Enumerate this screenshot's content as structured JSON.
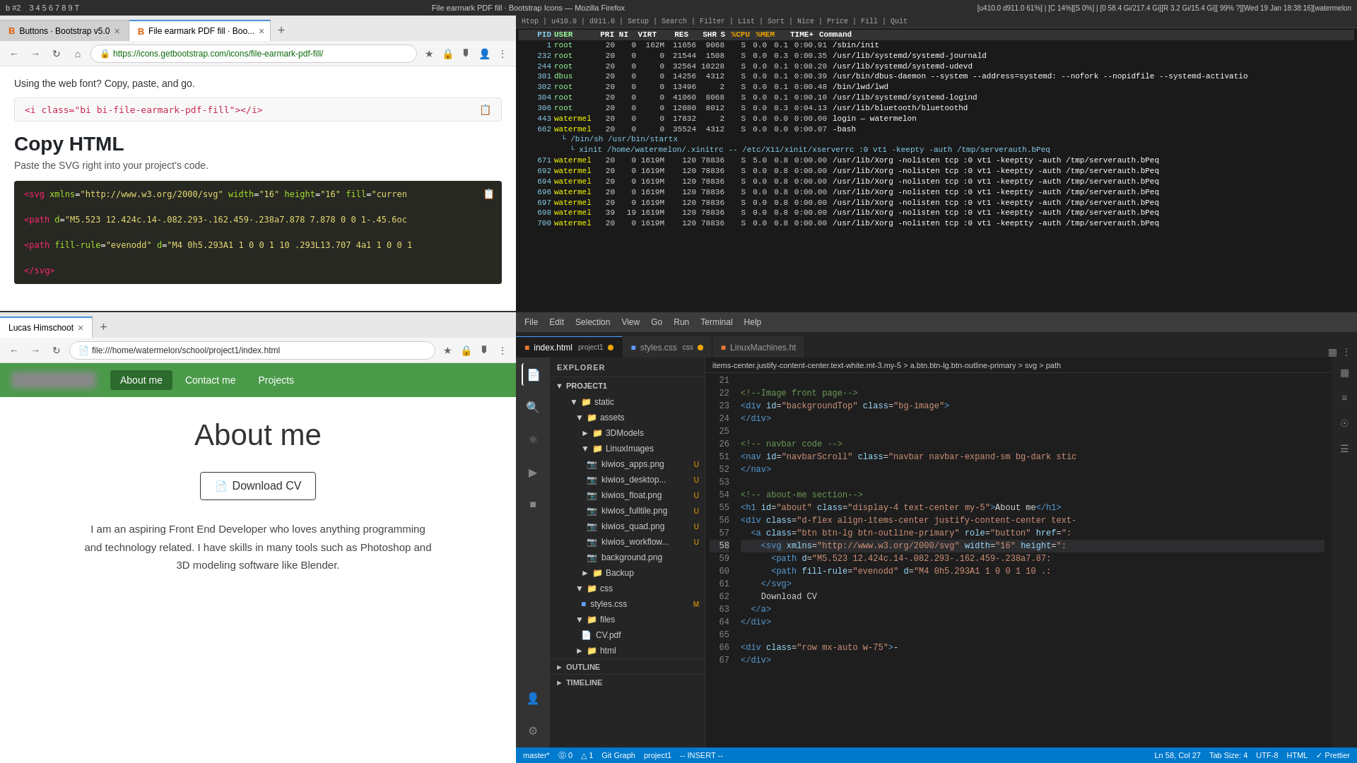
{
  "system_bar": {
    "workspace": "b #2",
    "items": "3 4 5 6 7 8 9 T",
    "title": "File earmark PDF fill · Bootstrap Icons — Mozilla Firefox",
    "stats": "[u410.0 d911.0 61%] | [C 14%][S 0%] | [0 58.4 Gi/217.4 Gi][R 3.2 Gi/15.4 Gi][ 99% ?][Wed 19 Jan 18:38:16][watermelon"
  },
  "top_browser": {
    "tabs": [
      {
        "label": "Buttons · Bootstrap v5.0",
        "active": false,
        "favicon": "B"
      },
      {
        "label": "File earmark PDF fill · Boo...",
        "active": true,
        "favicon": "B"
      }
    ],
    "address": "https://icons.getbootstrap.com/icons/file-earmark-pdf-fill/",
    "using_web_font": "Using the web font? Copy, paste, and go.",
    "code_snippet": "<i class=\"bi bi-file-earmark-pdf-fill\"></i>",
    "copy_html_title": "Copy HTML",
    "copy_html_sub": "Paste the SVG right into your project's code.",
    "svg_code": {
      "line1": "<svg xmlns=\"http://www.w3.org/2000/svg\" width=\"16\" height=\"16\" fill=\"curren",
      "line2": "  <path d=\"M5.523 12.424c.14-.082.293-.162.459-.238a7.878 7.878 0 0 1-.45.6oc",
      "line3": "  <path fill-rule=\"evenodd\" d=\"M4 0h5.293A1 1 0 0 1 10 .293L13.707 4a1 1 0 0 1",
      "line4": "</svg>"
    }
  },
  "bottom_browser": {
    "tab_label": "Lucas Himschoot",
    "address": "file:///home/watermelon/school/project1/index.html",
    "nav_links": [
      "About me",
      "Contact me",
      "Projects"
    ],
    "active_nav": "About me",
    "page_title": "About me",
    "download_cv_label": "Download CV",
    "bio": "I am an aspiring Front End Developer who loves anything programming and technology related. I have skills in many tools such as Photoshop and 3D modeling software like Blender."
  },
  "terminal": {
    "header": "htop | u410.0 | Setup | Search | Filter | List | Sort | Nice | Price | Fill | Quit",
    "rows": [
      {
        "pid": "1",
        "user": "root",
        "pri": "20",
        "ni": "0",
        "virt": "162M",
        "res": "11656",
        "shr": "9068",
        "s": "S",
        "cpu": "0.0",
        "mem": "0.1",
        "time": "0:00.91",
        "cmd": "/sbin/init"
      },
      {
        "pid": "232",
        "user": "root",
        "pri": "20",
        "ni": "0",
        "virt": "0",
        "res": "21544",
        "shr": "1508",
        "s": "S",
        "cpu": "0.0",
        "mem": "0.3",
        "time": "0:00.35",
        "cmd": "/usr/lib/systemd/systemd-journald"
      },
      {
        "pid": "244",
        "user": "root",
        "pri": "20",
        "ni": "0",
        "virt": "0",
        "res": "32564",
        "shr": "10228",
        "s": "S",
        "cpu": "0.0",
        "mem": "0.1",
        "time": "0:08.20",
        "cmd": "/usr/lib/systemd/systemd-udevd"
      },
      {
        "pid": "301",
        "user": "dbus",
        "pri": "20",
        "ni": "0",
        "virt": "0",
        "res": "14256",
        "shr": "4312",
        "s": "S",
        "cpu": "0.0",
        "mem": "0.1",
        "time": "0:00.39",
        "cmd": "/usr/bin/dbus-daemon --system --address=systemd: --nofork --nopidfile --systemd-activatio"
      },
      {
        "pid": "302",
        "user": "root",
        "pri": "20",
        "ni": "0",
        "virt": "0",
        "res": "13496",
        "shr": "2",
        "s": "S",
        "cpu": "0.0",
        "mem": "0.1",
        "time": "0:00.48",
        "cmd": "/bin/lwd/lwd"
      },
      {
        "pid": "304",
        "user": "root",
        "pri": "20",
        "ni": "0",
        "virt": "0",
        "res": "41060",
        "shr": "8068",
        "s": "S",
        "cpu": "0.0",
        "mem": "0.1",
        "time": "0:00.10",
        "cmd": "/usr/lib/systemd/systemd-logind"
      },
      {
        "pid": "306",
        "user": "root",
        "pri": "20",
        "ni": "0",
        "virt": "0",
        "res": "12080",
        "shr": "8012",
        "s": "S",
        "cpu": "0.0",
        "mem": "0.3",
        "time": "0:04.13",
        "cmd": "/usr/lib/bluetooth/bluetoothd"
      },
      {
        "pid": "443",
        "user": "watermel",
        "pri": "20",
        "ni": "0",
        "virt": "0",
        "res": "17832",
        "shr": "2",
        "s": "S",
        "cpu": "0.0",
        "mem": "0.0",
        "time": "0:00.00",
        "cmd": "login — watermelon"
      },
      {
        "pid": "662",
        "user": "watermel",
        "pri": "20",
        "ni": "0",
        "virt": "0",
        "res": "35524",
        "shr": "4312",
        "s": "S",
        "cpu": "0.0",
        "mem": "0.0",
        "time": "0:00.07",
        "cmd": "-bash"
      }
    ]
  },
  "vscode": {
    "menu": [
      "File",
      "Edit",
      "Selection",
      "View",
      "Go",
      "Run",
      "Terminal",
      "Help"
    ],
    "tabs": [
      {
        "label": "index.html",
        "project": "project1",
        "modified": true,
        "active": true
      },
      {
        "label": "styles.css",
        "project": "css",
        "modified": true,
        "active": false
      },
      {
        "label": "LinuxMachines.ht",
        "project": "",
        "modified": false,
        "active": false
      }
    ],
    "breadcrumb": "items-center.justify-content-center.text-white.mt-3.my-5 > a.btn.btn-lg.btn-outline-primary > svg > path",
    "active_line": 58,
    "lines": [
      {
        "num": 21,
        "content": "",
        "type": "empty"
      },
      {
        "num": 22,
        "content": "<!--Image front page-->",
        "type": "comment"
      },
      {
        "num": 23,
        "content": "  <div id=\"backgroundTop\" class=\"bg-image\">",
        "type": "html"
      },
      {
        "num": 24,
        "content": "  </div>",
        "type": "html"
      },
      {
        "num": 25,
        "content": "",
        "type": "empty"
      },
      {
        "num": 26,
        "content": "<!-- navbar code -->",
        "type": "comment"
      },
      {
        "num": 51,
        "content": "  <nav id=\"navbarScroll\" class=\"navbar navbar-expand-sm bg-dark stic",
        "type": "html"
      },
      {
        "num": 52,
        "content": "  </nav>",
        "type": "html"
      },
      {
        "num": 53,
        "content": "",
        "type": "empty"
      },
      {
        "num": 54,
        "content": "<!-- about-me section-->",
        "type": "comment"
      },
      {
        "num": 55,
        "content": "  <h1 id=\"about\" class=\"display-4 text-center my-5\">About me</h1>",
        "type": "html"
      },
      {
        "num": 56,
        "content": "  <div class=\"d-flex align-items-center justify-content-center text-",
        "type": "html"
      },
      {
        "num": 57,
        "content": "    <a class=\"btn btn-lg btn-outline-primary\" role=\"button\" href=\":",
        "type": "html"
      },
      {
        "num": 58,
        "content": "      <svg xmlns=\"http://www.w3.org/2000/svg\" width=\"16\" height=\":",
        "type": "html",
        "active": true
      },
      {
        "num": 59,
        "content": "        <path d=\"M5.523 12.424c.14-.082.293-.162.459-.238a7.87:",
        "type": "html"
      },
      {
        "num": 60,
        "content": "        <path fill-rule=\"evenodd\" d=\"M4 0h5.293A1 1 0 0 1 10 .:",
        "type": "html"
      },
      {
        "num": 61,
        "content": "      </svg>",
        "type": "html"
      },
      {
        "num": 62,
        "content": "      Download CV",
        "type": "text"
      },
      {
        "num": 63,
        "content": "    </a>",
        "type": "html"
      },
      {
        "num": 64,
        "content": "  </div>",
        "type": "html"
      },
      {
        "num": 65,
        "content": "",
        "type": "empty"
      },
      {
        "num": 66,
        "content": "  <div class=\"row mx-auto w-75\">-",
        "type": "html"
      },
      {
        "num": 67,
        "content": "  </div>",
        "type": "html"
      }
    ],
    "explorer": {
      "title": "EXPLORER",
      "project_name": "PROJECT1",
      "items": [
        {
          "type": "folder",
          "name": "static",
          "indent": 1,
          "open": true
        },
        {
          "type": "folder",
          "name": "assets",
          "indent": 2,
          "open": true
        },
        {
          "type": "folder",
          "name": "3DModels",
          "indent": 3,
          "open": true
        },
        {
          "type": "folder",
          "name": "LinuxImages",
          "indent": 3,
          "open": true
        },
        {
          "type": "file",
          "name": "kiwios_apps.png",
          "indent": 4,
          "badge": "U"
        },
        {
          "type": "file",
          "name": "kiwios_desktop...",
          "indent": 4,
          "badge": "U"
        },
        {
          "type": "file",
          "name": "kiwios_float.png",
          "indent": 4,
          "badge": "U"
        },
        {
          "type": "file",
          "name": "kiwios_fulltile.png",
          "indent": 4,
          "badge": "U"
        },
        {
          "type": "file",
          "name": "kiwios_quad.png",
          "indent": 4,
          "badge": "U"
        },
        {
          "type": "file",
          "name": "kiwios_workflow...",
          "indent": 4,
          "badge": "U"
        },
        {
          "type": "file",
          "name": "background.png",
          "indent": 4,
          "badge": ""
        },
        {
          "type": "folder",
          "name": "Backup",
          "indent": 3,
          "open": false
        },
        {
          "type": "folder",
          "name": "css",
          "indent": 2,
          "open": true
        },
        {
          "type": "file",
          "name": "styles.css",
          "indent": 3,
          "badge": "M"
        },
        {
          "type": "folder",
          "name": "files",
          "indent": 2,
          "open": true
        },
        {
          "type": "file",
          "name": "CV.pdf",
          "indent": 3,
          "badge": ""
        },
        {
          "type": "folder",
          "name": "html",
          "indent": 2,
          "open": false
        }
      ],
      "outline_label": "OUTLINE",
      "timeline_label": "TIMELINE"
    },
    "statusbar": {
      "branch": "master*",
      "errors": "⓪ 0",
      "warnings": "△ 1",
      "info": "Git Graph",
      "project": "project1",
      "mode": "-- INSERT --",
      "ln_col": "Ln 58, Col 27",
      "tab_size": "Tab Size: 4",
      "encoding": "UTF-8",
      "lang": "HTML",
      "prettier": "✓ Prettier"
    }
  }
}
